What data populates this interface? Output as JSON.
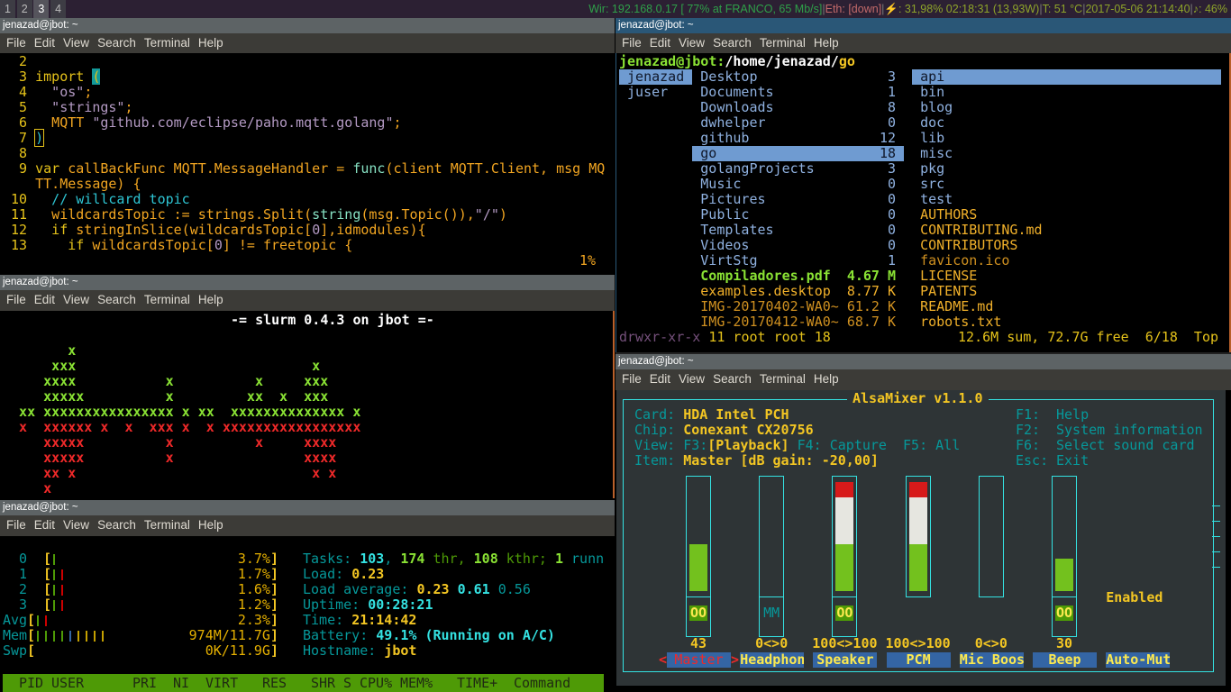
{
  "topbar": {
    "workspaces": [
      "1",
      "2",
      "3",
      "4"
    ],
    "active_workspace": "3",
    "status": [
      {
        "text": "Wir: 192.168.0.17 [ 77% at FRANCO, 65 Mb/s]",
        "color": "st-g"
      },
      {
        "text": "|",
        "color": "st-s"
      },
      {
        "text": "Eth: [down]",
        "color": "st-r"
      },
      {
        "text": "|",
        "color": "st-s"
      },
      {
        "text": "⚡: 31,98% 02:18:31 (13,93W)",
        "color": "st-o"
      },
      {
        "text": "|",
        "color": "st-s"
      },
      {
        "text": "T: 51 °C",
        "color": "st-o"
      },
      {
        "text": "|",
        "color": "st-s"
      },
      {
        "text": "2017-05-06 21:14:40",
        "color": "st-o"
      },
      {
        "text": "|",
        "color": "st-s"
      },
      {
        "text": "♪: 46%",
        "color": "st-o"
      }
    ]
  },
  "menu": [
    "File",
    "Edit",
    "View",
    "Search",
    "Terminal",
    "Help"
  ],
  "windows": {
    "vim": {
      "title": "jenazad@jbot: ~"
    },
    "slurm": {
      "title": "jenazad@jbot: ~"
    },
    "htop": {
      "title": "jenazad@jbot: ~"
    },
    "ranger": {
      "title": "jenazad@jbot: ~"
    },
    "alsa": {
      "title": "jenazad@jbot: ~"
    }
  },
  "vim": {
    "lines": [
      [
        [
          "  2 ",
          "n"
        ]
      ],
      [
        [
          "  3 ",
          "n"
        ],
        [
          "import ",
          "k"
        ],
        [
          "(",
          "pb"
        ]
      ],
      [
        [
          "  4 ",
          "n"
        ],
        [
          "  \"os\"",
          "s"
        ],
        [
          ";",
          "o"
        ]
      ],
      [
        [
          "  5 ",
          "n"
        ],
        [
          "  \"strings\"",
          "s"
        ],
        [
          ";",
          "o"
        ]
      ],
      [
        [
          "  6 ",
          "n"
        ],
        [
          "  MQTT ",
          "o"
        ],
        [
          "\"github.com/eclipse/paho.mqtt.golang\"",
          "s"
        ],
        [
          ";",
          "o"
        ]
      ],
      [
        [
          "  7 ",
          "n"
        ],
        [
          ")",
          "cur"
        ]
      ],
      [
        [
          "  8 ",
          "n"
        ]
      ],
      [
        [
          "  9 ",
          "n"
        ],
        [
          "var ",
          "k"
        ],
        [
          "callBackFunc MQTT.MessageHandler = ",
          "o"
        ],
        [
          "func",
          "f"
        ],
        [
          "(client MQTT.Client, msg MQ",
          "o"
        ]
      ],
      [
        [
          "    ",
          ""
        ],
        [
          "TT.Message) {",
          "o"
        ]
      ],
      [
        [
          " 10 ",
          "n"
        ],
        [
          "  // willcard topic",
          "c"
        ]
      ],
      [
        [
          " 11 ",
          "n"
        ],
        [
          "  wildcardsTopic := strings.Split(",
          "o"
        ],
        [
          "string",
          "f"
        ],
        [
          "(msg.Topic()),",
          "o"
        ],
        [
          "\"/\"",
          "s"
        ],
        [
          ")",
          "o"
        ]
      ],
      [
        [
          " 12 ",
          "n"
        ],
        [
          "  if ",
          "k"
        ],
        [
          "stringInSlice(wildcardsTopic[",
          "o"
        ],
        [
          "0",
          "s"
        ],
        [
          "],idmodules){",
          "o"
        ]
      ],
      [
        [
          " 13 ",
          "n"
        ],
        [
          "    if ",
          "k"
        ],
        [
          "wildcardsTopic[",
          "o"
        ],
        [
          "0",
          "s"
        ],
        [
          "] != freetopic {",
          "o"
        ]
      ]
    ],
    "cursor_pos": "7,1",
    "scroll_pct": "1%"
  },
  "slurm": {
    "header": "-= slurm 0.4.3 on jbot =-",
    "rx_rows": [
      "        x",
      "      xxx                             x",
      "     xxxx           x          x     xxx",
      "     xxxxx          x         xx  x  xxx",
      "  xx xxxxxxxxxxxxxxxx x xx  xxxxxxxxxxxxxx x"
    ],
    "tx_rows": [
      "  x  xxxxxx x  x  xxx x  x xxxxxxxxxxxxxxxxx",
      "     xxxxx          x          x     xxxx",
      "     xxxxx          x                xxxx",
      "     xx x                             x x",
      "     x"
    ]
  },
  "htop": {
    "meters": [
      {
        "label": "0",
        "bars": [
          "gl"
        ],
        "value": "3.7%"
      },
      {
        "label": "1",
        "bars": [
          "gl",
          "red"
        ],
        "value": "1.7%"
      },
      {
        "label": "2",
        "bars": [
          "gl",
          "red"
        ],
        "value": "1.6%"
      },
      {
        "label": "3",
        "bars": [
          "gl",
          "red"
        ],
        "value": "1.2%"
      },
      {
        "label": "Avg",
        "bars": [
          "gl",
          "red"
        ],
        "value": "2.3%"
      },
      {
        "label": "Mem",
        "bars": [
          "gl",
          "gl",
          "gl",
          "gl",
          "blue",
          "org",
          "org",
          "org",
          "org"
        ],
        "value": "974M/11.7G"
      },
      {
        "label": "Swp",
        "bars": [],
        "value": "0K/11.9G"
      }
    ],
    "info": [
      [
        [
          "Tasks: ",
          "tl"
        ],
        [
          "103",
          "tv"
        ],
        [
          ", ",
          "tl"
        ],
        [
          "174",
          "gv"
        ],
        [
          " thr, ",
          "gl"
        ],
        [
          "108",
          "gv"
        ],
        [
          " kthr; ",
          "gl"
        ],
        [
          "1",
          "gv"
        ],
        [
          " runn",
          "tl"
        ]
      ],
      [
        [
          "Load: ",
          "tl"
        ],
        [
          "0.23",
          "yv"
        ]
      ],
      [
        [
          "Load average: ",
          "tl"
        ],
        [
          "0.23 ",
          "yv"
        ],
        [
          "0.61 ",
          "tv"
        ],
        [
          "0.56",
          "tl"
        ]
      ],
      [
        [
          "Uptime: ",
          "tl"
        ],
        [
          "00:28:21",
          "tv"
        ]
      ],
      [
        [
          "Time: ",
          "tl"
        ],
        [
          "21:14:42",
          "yv"
        ]
      ],
      [
        [
          "Battery: ",
          "tl"
        ],
        [
          "49.1% (Running on A/C)",
          "tv"
        ]
      ],
      [
        [
          "Hostname: ",
          "tl"
        ],
        [
          "jbot",
          "yv"
        ]
      ]
    ],
    "columns": [
      "PID",
      "USER",
      "PRI",
      "NI",
      "VIRT",
      "RES",
      "SHR",
      "S",
      "CPU%",
      "MEM%",
      "TIME+",
      "Command"
    ],
    "colors": {
      "header_bg": "#4e9a06",
      "gl": "#4e9a06",
      "red": "#cc0000",
      "blue": "#3465a4",
      "org": "#c4a000"
    }
  },
  "ranger": {
    "path_user": "jenazad@jbot:",
    "path_dir": "/home/jenazad/",
    "path_current": "go",
    "parent": [
      {
        "name": "jenazad",
        "selected": true
      },
      {
        "name": "juser"
      }
    ],
    "current": [
      {
        "name": "Desktop",
        "info": "3",
        "type": "dir"
      },
      {
        "name": "Documents",
        "info": "1",
        "type": "dir"
      },
      {
        "name": "Downloads",
        "info": "8",
        "type": "dir"
      },
      {
        "name": "dwhelper",
        "info": "0",
        "type": "dir"
      },
      {
        "name": "github",
        "info": "12",
        "type": "dir"
      },
      {
        "name": "go",
        "info": "18",
        "type": "dir",
        "selected": true
      },
      {
        "name": "golangProjects",
        "info": "3",
        "type": "dir"
      },
      {
        "name": "Music",
        "info": "0",
        "type": "dir"
      },
      {
        "name": "Pictures",
        "info": "0",
        "type": "dir"
      },
      {
        "name": "Public",
        "info": "0",
        "type": "dir"
      },
      {
        "name": "Templates",
        "info": "0",
        "type": "dir"
      },
      {
        "name": "Videos",
        "info": "0",
        "type": "dir"
      },
      {
        "name": "VirtStg",
        "info": "1",
        "type": "dir"
      },
      {
        "name": "Compiladores.pdf",
        "info": "4.67 M",
        "type": "pdf"
      },
      {
        "name": "examples.desktop",
        "info": "8.77 K",
        "type": "org"
      },
      {
        "name": "IMG-20170402-WA0~",
        "info": "61.2 K",
        "type": "dorg"
      },
      {
        "name": "IMG-20170412-WA0~",
        "info": "68.7 K",
        "type": "dorg"
      }
    ],
    "preview": [
      {
        "name": "api",
        "type": "dir",
        "selected": true
      },
      {
        "name": "bin",
        "type": "dir"
      },
      {
        "name": "blog",
        "type": "dir"
      },
      {
        "name": "doc",
        "type": "dir"
      },
      {
        "name": "lib",
        "type": "dir"
      },
      {
        "name": "misc",
        "type": "dir"
      },
      {
        "name": "pkg",
        "type": "dir"
      },
      {
        "name": "src",
        "type": "dir"
      },
      {
        "name": "test",
        "type": "dir"
      },
      {
        "name": "AUTHORS",
        "type": "org"
      },
      {
        "name": "CONTRIBUTING.md",
        "type": "org"
      },
      {
        "name": "CONTRIBUTORS",
        "type": "org"
      },
      {
        "name": "favicon.ico",
        "type": "dorg"
      },
      {
        "name": "LICENSE",
        "type": "org"
      },
      {
        "name": "PATENTS",
        "type": "org"
      },
      {
        "name": "README.md",
        "type": "org"
      },
      {
        "name": "robots.txt",
        "type": "org"
      }
    ],
    "status_perms": "drwxr-xr-x",
    "status_info": " 11 root root 18",
    "status_right": "12.6M sum, 72.7G free  6/18  Top"
  },
  "alsa": {
    "title": "AlsaMixer v1.1.0",
    "info": [
      [
        [
          "Card: ",
          "tl"
        ],
        [
          "HDA Intel PCH",
          "yv"
        ]
      ],
      [
        [
          "Chip: ",
          "tl"
        ],
        [
          "Conexant CX20756",
          "yv"
        ]
      ],
      [
        [
          "View: ",
          "tl"
        ],
        [
          "F3:",
          "tl"
        ],
        [
          "[Playback]",
          "yv"
        ],
        [
          " F4: Capture  F5: All",
          "tl"
        ]
      ],
      [
        [
          "Item: ",
          "tl"
        ],
        [
          "Master [dB gain: -20,00]",
          "yv"
        ]
      ]
    ],
    "keys": [
      [
        "F1:",
        "Help"
      ],
      [
        "F2:",
        "System information"
      ],
      [
        "F6:",
        "Select sound card"
      ],
      [
        "Esc:",
        "Exit"
      ]
    ],
    "channels": [
      {
        "name": "Master",
        "value": "43",
        "level": 43,
        "mute": "OO",
        "selected": true
      },
      {
        "name": "Headphon",
        "value": "0<>0",
        "level": 0,
        "mute": "MM"
      },
      {
        "name": "Speaker",
        "value": "100<>100",
        "level": 100,
        "mute": "OO"
      },
      {
        "name": "PCM",
        "value": "100<>100",
        "level": 100
      },
      {
        "name": "Mic Boos",
        "value": "0<>0",
        "level": 0
      },
      {
        "name": "Beep",
        "value": "30",
        "level": 30,
        "mute": "OO"
      },
      {
        "name": "Auto-Mut",
        "value": "",
        "enum": "Enabled"
      }
    ],
    "colors": {
      "border": "#34e2e2",
      "bg": "#2e3436",
      "green": "#73c11e",
      "white": "#e6e6e0",
      "red": "#d71a1a",
      "name_bg": "#3465a4"
    }
  }
}
